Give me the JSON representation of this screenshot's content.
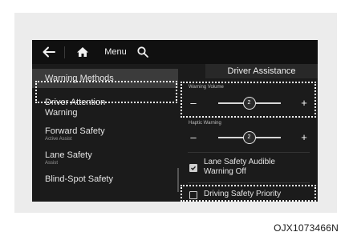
{
  "topbar": {
    "back_icon": "arrow-left-icon",
    "home_icon": "home-icon",
    "menu_label": "Menu",
    "search_icon": "search-icon"
  },
  "header": {
    "title": "Driver Assistance"
  },
  "sidebar": {
    "items": [
      {
        "label": "Warning Methods",
        "selected": true
      },
      {
        "label": "Driver Attention\nWarning"
      },
      {
        "label": "Forward Safety",
        "sublabel": "Active Assist"
      },
      {
        "label": "Lane Safety",
        "sublabel": "Assist"
      },
      {
        "label": "Blind-Spot Safety"
      }
    ]
  },
  "warning_volume": {
    "label": "Warning Volume",
    "minus": "–",
    "plus": "+",
    "value": "2",
    "level": 0.5
  },
  "haptic_warning": {
    "label": "Haptic Warning",
    "minus": "–",
    "plus": "+",
    "value": "2",
    "level": 0.5
  },
  "options": {
    "lane_safety_audible": {
      "label": "Lane Safety Audible\nWarning Off",
      "checked": true
    },
    "driving_safety_priority": {
      "label": "Driving Safety Priority",
      "checked": false
    }
  },
  "caption": "OJX1073466N",
  "colors": {
    "screen_bg": "#1b1b1b",
    "highlight_dots": "#ffffff",
    "frame_bg": "#ececec"
  }
}
